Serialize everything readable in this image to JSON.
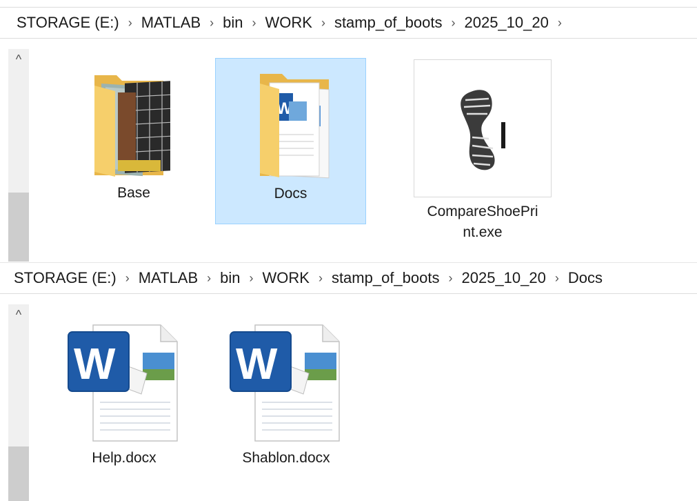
{
  "top_window": {
    "breadcrumb": [
      "STORAGE (E:)",
      "MATLAB",
      "bin",
      "WORK",
      "stamp_of_boots",
      "2025_10_20"
    ],
    "items": [
      {
        "name": "Base",
        "icon": "folder-with-images-icon"
      },
      {
        "name": "Docs",
        "icon": "folder-with-documents-icon",
        "selected": true
      },
      {
        "name": "CompareShoePri\nnt.exe",
        "icon": "shoeprint-app-icon"
      }
    ]
  },
  "bottom_window": {
    "breadcrumb": [
      "STORAGE (E:)",
      "MATLAB",
      "bin",
      "WORK",
      "stamp_of_boots",
      "2025_10_20",
      "Docs"
    ],
    "items": [
      {
        "name": "Help.docx",
        "icon": "word-document-icon"
      },
      {
        "name": "Shablon.docx",
        "icon": "word-document-icon"
      }
    ]
  },
  "icons": {
    "scroll_up": "^",
    "breadcrumb_separator": "›"
  },
  "colors": {
    "selection_bg": "#cce8ff",
    "selection_border": "#99d1ff",
    "folder": "#f6cf6b",
    "word_blue": "#1f5ba8"
  }
}
